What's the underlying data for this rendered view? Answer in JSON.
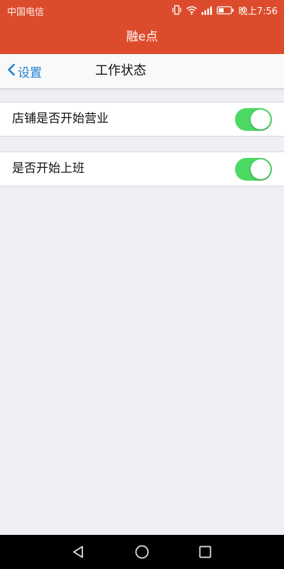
{
  "status_bar": {
    "carrier": "中国电信",
    "time": "晚上7:56",
    "icons": [
      "vibrate-icon",
      "wifi-icon",
      "signal-icon",
      "battery-icon"
    ]
  },
  "app_header": {
    "title": "融e点"
  },
  "nav_bar": {
    "back_label": "设置",
    "title": "工作状态"
  },
  "settings": [
    {
      "label": "店铺是否开始营业",
      "enabled": true
    },
    {
      "label": "是否开始上班",
      "enabled": true
    }
  ],
  "colors": {
    "header": "#dc4c2c",
    "accent": "#1a7fd4",
    "toggle_on": "#4cd964",
    "background": "#efeff4"
  },
  "system_nav": {
    "buttons": [
      "back-triangle-icon",
      "home-circle-icon",
      "recents-square-icon"
    ]
  }
}
